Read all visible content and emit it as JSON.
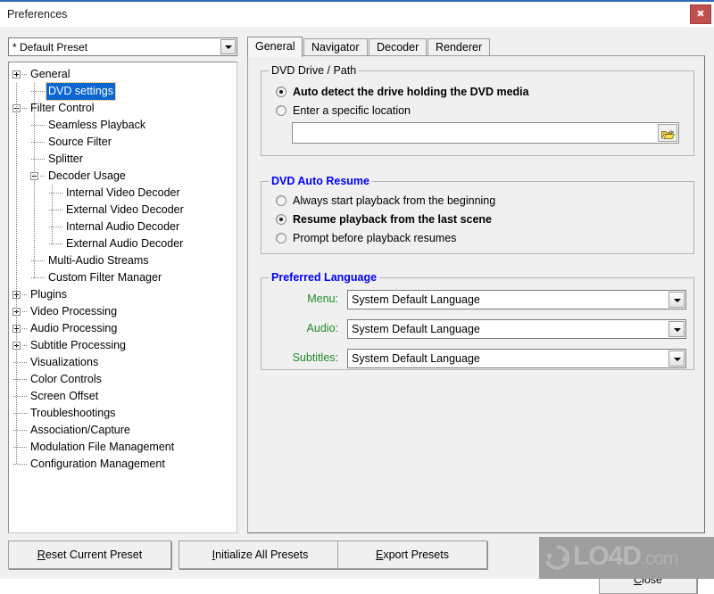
{
  "window": {
    "title": "Preferences",
    "close_icon": "close-x-icon",
    "accent": "#2b6cb8",
    "close_button_color": "#c0504d"
  },
  "preset": {
    "selected": "* Default Preset",
    "dropdown_icon": "chevron-down-icon"
  },
  "tree": {
    "items": [
      {
        "label": "General",
        "depth": 0,
        "state": "collapsed",
        "selected": false
      },
      {
        "label": "DVD settings",
        "depth": 1,
        "state": "leaf",
        "selected": true
      },
      {
        "label": "Filter Control",
        "depth": 0,
        "state": "expanded",
        "selected": false
      },
      {
        "label": "Seamless Playback",
        "depth": 1,
        "state": "leaf",
        "selected": false
      },
      {
        "label": "Source Filter",
        "depth": 1,
        "state": "leaf",
        "selected": false
      },
      {
        "label": "Splitter",
        "depth": 1,
        "state": "leaf",
        "selected": false
      },
      {
        "label": "Decoder Usage",
        "depth": 1,
        "state": "expanded",
        "selected": false
      },
      {
        "label": "Internal Video Decoder",
        "depth": 2,
        "state": "leaf",
        "selected": false
      },
      {
        "label": "External Video Decoder",
        "depth": 2,
        "state": "leaf",
        "selected": false
      },
      {
        "label": "Internal Audio Decoder",
        "depth": 2,
        "state": "leaf",
        "selected": false
      },
      {
        "label": "External Audio Decoder",
        "depth": 2,
        "state": "leaf",
        "selected": false
      },
      {
        "label": "Multi-Audio Streams",
        "depth": 1,
        "state": "leaf",
        "selected": false
      },
      {
        "label": "Custom Filter Manager",
        "depth": 1,
        "state": "leaf",
        "selected": false
      },
      {
        "label": "Plugins",
        "depth": 0,
        "state": "collapsed",
        "selected": false
      },
      {
        "label": "Video Processing",
        "depth": 0,
        "state": "collapsed",
        "selected": false
      },
      {
        "label": "Audio Processing",
        "depth": 0,
        "state": "collapsed",
        "selected": false
      },
      {
        "label": "Subtitle Processing",
        "depth": 0,
        "state": "collapsed",
        "selected": false
      },
      {
        "label": "Visualizations",
        "depth": 0,
        "state": "leaf",
        "selected": false
      },
      {
        "label": "Color Controls",
        "depth": 0,
        "state": "leaf",
        "selected": false
      },
      {
        "label": "Screen Offset",
        "depth": 0,
        "state": "leaf",
        "selected": false
      },
      {
        "label": "Troubleshootings",
        "depth": 0,
        "state": "leaf",
        "selected": false
      },
      {
        "label": "Association/Capture",
        "depth": 0,
        "state": "leaf",
        "selected": false
      },
      {
        "label": "Modulation File Management",
        "depth": 0,
        "state": "leaf",
        "selected": false
      },
      {
        "label": "Configuration Management",
        "depth": 0,
        "state": "leaf",
        "selected": false
      }
    ]
  },
  "tabs": [
    {
      "label": "General",
      "active": true
    },
    {
      "label": "Navigator",
      "active": false
    },
    {
      "label": "Decoder",
      "active": false
    },
    {
      "label": "Renderer",
      "active": false
    }
  ],
  "dvd_drive_path": {
    "title": "DVD Drive / Path",
    "title_color": "#000000",
    "options": [
      {
        "label": "Auto detect the drive holding the DVD media",
        "checked": true
      },
      {
        "label": "Enter a specific location",
        "checked": false
      }
    ],
    "path_value": "",
    "path_placeholder": "",
    "browse_icon": "open-folder-icon"
  },
  "dvd_auto_resume": {
    "title": "DVD Auto Resume",
    "title_color": "#0000ff",
    "options": [
      {
        "label": "Always start playback from the beginning",
        "checked": false
      },
      {
        "label": "Resume playback from the last scene",
        "checked": true
      },
      {
        "label": "Prompt before playback resumes",
        "checked": false
      }
    ]
  },
  "preferred_language": {
    "title": "Preferred Language",
    "title_color": "#0000ff",
    "label_color": "#1f8b28",
    "rows": [
      {
        "label": "Menu:",
        "value": "System Default Language"
      },
      {
        "label": "Audio:",
        "value": "System Default Language"
      },
      {
        "label": "Subtitles:",
        "value": "System Default Language"
      }
    ]
  },
  "footer": {
    "buttons": [
      {
        "accel": "R",
        "rest": "eset Current Preset"
      },
      {
        "accel": "I",
        "rest": "nitialize All Presets"
      },
      {
        "accel": "E",
        "rest": "xport Presets"
      }
    ],
    "close": {
      "accel": "C",
      "rest": "lose"
    }
  },
  "watermark": {
    "main": "LO4D",
    "suffix": ".com",
    "logo_icon": "refresh-circle-logo-icon"
  }
}
